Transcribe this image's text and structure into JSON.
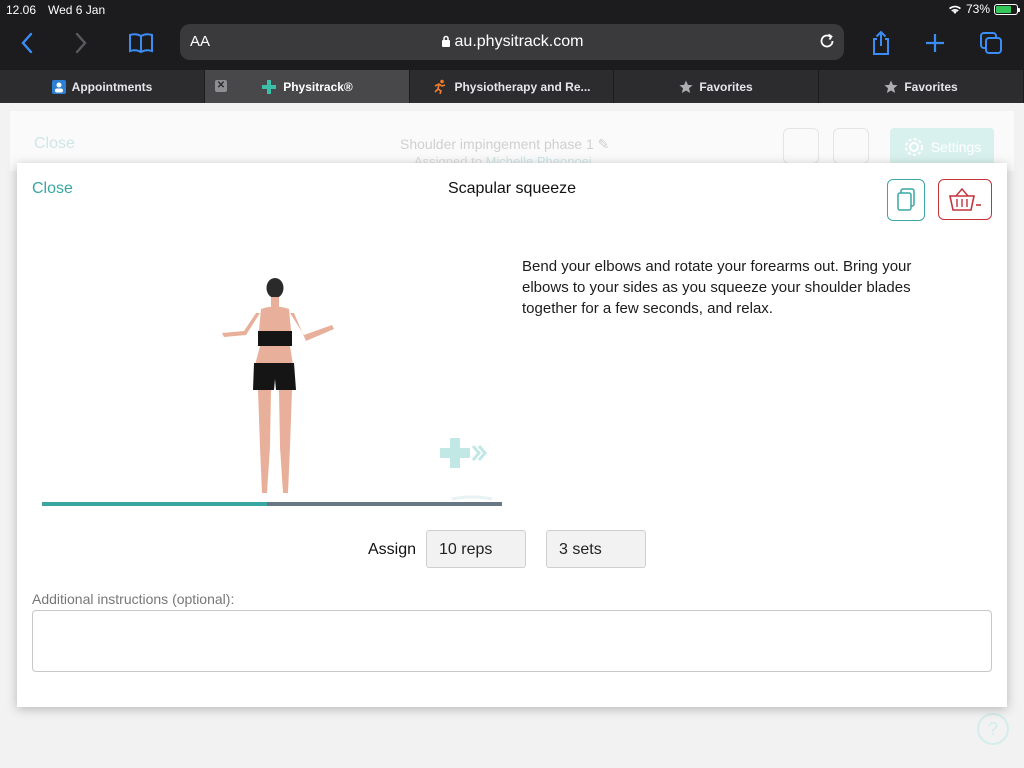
{
  "status": {
    "time": "12.06",
    "date": "Wed 6 Jan",
    "battery": "73%",
    "battery_level": 0.73
  },
  "browser": {
    "text_size_label": "AA",
    "url": "au.physitrack.com"
  },
  "tabs": [
    {
      "label": "Appointments"
    },
    {
      "label": "Physitrack®"
    },
    {
      "label": "Physiotherapy and Re..."
    },
    {
      "label": "Favorites"
    },
    {
      "label": "Favorites"
    }
  ],
  "background": {
    "close": "Close",
    "program_title": "Shoulder impingement phase 1",
    "assigned_prefix": "Assigned to",
    "assigned_name": "Michelle Pheonoei",
    "settings": "Settings"
  },
  "modal": {
    "close": "Close",
    "title": "Scapular squeeze",
    "description": "Bend your elbows and rotate your forearms out. Bring your elbows to your sides as you squeeze your shoulder blades together for a few seconds, and relax.",
    "video_progress": 0.49,
    "assign_label": "Assign",
    "reps": "10 reps",
    "sets": "3 sets",
    "additional_label": "Additional instructions (optional):",
    "additional_value": ""
  },
  "help": "?",
  "colors": {
    "accent": "#3aa7a3",
    "danger": "#c4333a",
    "chrome": "#1c1c1e"
  },
  "icons": [
    "back-icon",
    "forward-icon",
    "bookmarks-icon",
    "lock-icon",
    "reload-icon",
    "share-icon",
    "new-tab-icon",
    "tabs-icon",
    "copy-icon",
    "basket-remove-icon",
    "settings-gear-icon",
    "physitrack-logo-icon"
  ]
}
